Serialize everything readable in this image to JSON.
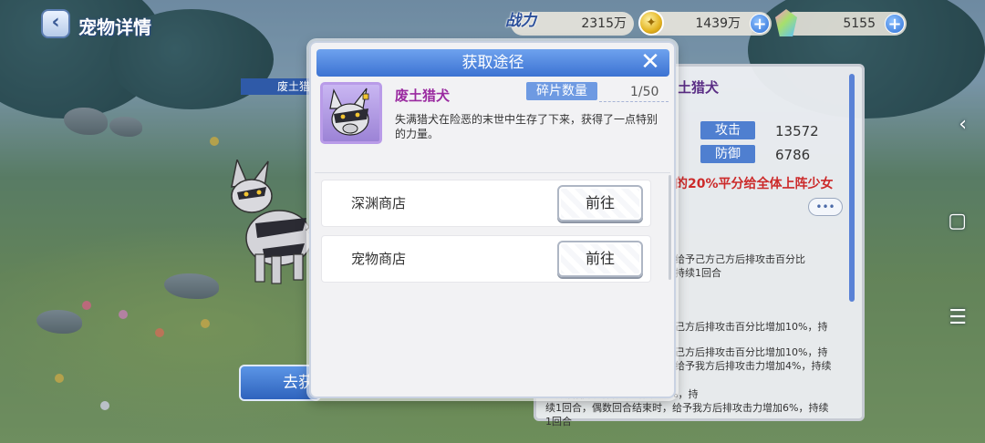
{
  "header": {
    "title": "宠物详情"
  },
  "resources": {
    "power_label": "战力",
    "power_value": "2315万",
    "gold_value": "1439万",
    "gem_value": "5155"
  },
  "left": {
    "tag_label": "废土猎",
    "go_button_label": "去获"
  },
  "detail_panel": {
    "pet_name": "土猎犬",
    "stats": [
      {
        "label": "攻击",
        "value": "13572"
      },
      {
        "label": "防御",
        "value": "6786"
      }
    ],
    "skill_highlight": "的20%平分给全体上阵少女",
    "more_label": "•••",
    "skill_texts": [
      "给予己方己方后排攻击百分比\n持续1回合",
      "己方后排攻击百分比增加10%，持",
      "己方后排攻击百分比增加10%，持\n给予我方后排攻击力增加4%，持续",
      "己方后排攻击百分比增加10%，持\n续1回合，偶数回合结束时，给予我方后排攻击力增加6%，持续\n1回合"
    ]
  },
  "modal": {
    "title": "获取途径",
    "close_label": "✕",
    "pet_name": "废土猎犬",
    "fragment_label": "碎片数量",
    "fragment_count": "1/50",
    "description": "失满猎犬在险恶的末世中生存了下来，获得了一点特别的力量。",
    "routes": [
      {
        "name": "深渊商店",
        "button": "前往"
      },
      {
        "name": "宠物商店",
        "button": "前往"
      }
    ]
  },
  "system_nav": {
    "back": "‹",
    "home": "▢",
    "menu": "☰"
  }
}
